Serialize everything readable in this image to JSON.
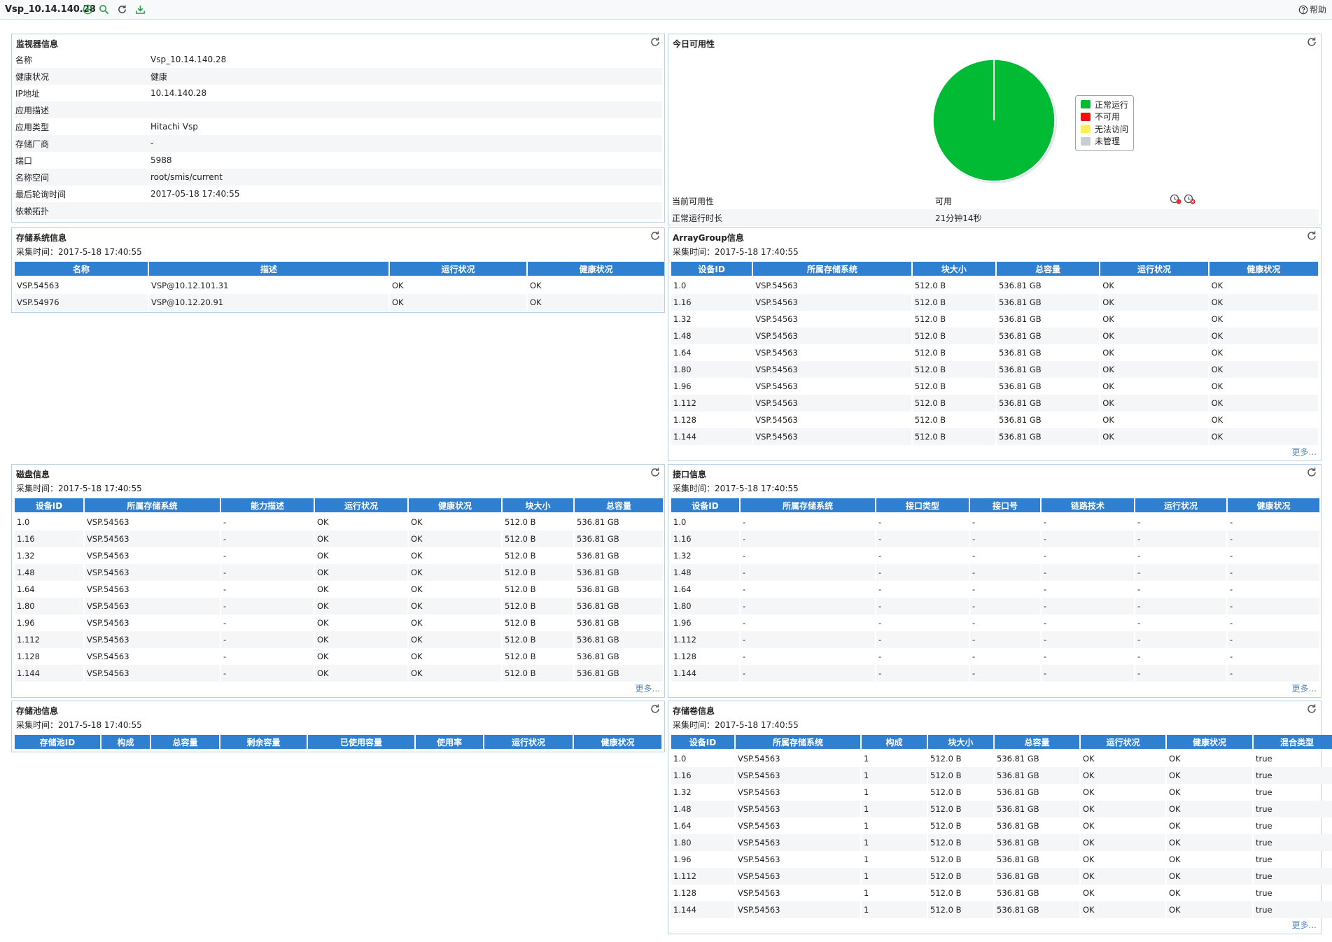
{
  "header": {
    "title": "Vsp_10.14.140.28",
    "help_label": "帮助"
  },
  "common": {
    "more_label": "更多...",
    "collect_time": "采集时间：2017-5-18 17:40:55"
  },
  "monitor": {
    "title": "监视器信息",
    "rows": [
      {
        "k": "名称",
        "v": "Vsp_10.14.140.28"
      },
      {
        "k": "健康状况",
        "v": "健康"
      },
      {
        "k": "IP地址",
        "v": "10.14.140.28"
      },
      {
        "k": "应用描述",
        "v": ""
      },
      {
        "k": "应用类型",
        "v": "Hitachi Vsp"
      },
      {
        "k": "存储厂商",
        "v": "-"
      },
      {
        "k": "端口",
        "v": "5988"
      },
      {
        "k": "名称空间",
        "v": "root/smis/current"
      },
      {
        "k": "最后轮询时间",
        "v": "2017-05-18 17:40:55"
      },
      {
        "k": "依赖拓扑",
        "v": ""
      }
    ]
  },
  "availability": {
    "title": "今日可用性",
    "legend": [
      {
        "label": "正常运行",
        "color": "#00bb33"
      },
      {
        "label": "不可用",
        "color": "#ee1111"
      },
      {
        "label": "无法访问",
        "color": "#ffee55"
      },
      {
        "label": "未管理",
        "color": "#c8ccd4"
      }
    ],
    "pie_values": {
      "正常运行": 100,
      "不可用": 0,
      "无法访问": 0,
      "未管理": 0
    },
    "rows": [
      {
        "k": "当前可用性",
        "v": "可用"
      },
      {
        "k": "正常运行时长",
        "v": "21分钟14秒"
      }
    ]
  },
  "storage_system": {
    "title": "存储系统信息",
    "headers": [
      "名称",
      "描述",
      "运行状况",
      "健康状况"
    ],
    "rows": [
      [
        "VSP.54563",
        "VSP@10.12.101.31",
        "OK",
        "OK"
      ],
      [
        "VSP.54976",
        "VSP@10.12.20.91",
        "OK",
        "OK"
      ]
    ]
  },
  "array_group": {
    "title": "ArrayGroup信息",
    "headers": [
      "设备ID",
      "所属存储系统",
      "块大小",
      "总容量",
      "运行状况",
      "健康状况"
    ],
    "rows": [
      [
        "1.0",
        "VSP.54563",
        "512.0 B",
        "536.81 GB",
        "OK",
        "OK"
      ],
      [
        "1.16",
        "VSP.54563",
        "512.0 B",
        "536.81 GB",
        "OK",
        "OK"
      ],
      [
        "1.32",
        "VSP.54563",
        "512.0 B",
        "536.81 GB",
        "OK",
        "OK"
      ],
      [
        "1.48",
        "VSP.54563",
        "512.0 B",
        "536.81 GB",
        "OK",
        "OK"
      ],
      [
        "1.64",
        "VSP.54563",
        "512.0 B",
        "536.81 GB",
        "OK",
        "OK"
      ],
      [
        "1.80",
        "VSP.54563",
        "512.0 B",
        "536.81 GB",
        "OK",
        "OK"
      ],
      [
        "1.96",
        "VSP.54563",
        "512.0 B",
        "536.81 GB",
        "OK",
        "OK"
      ],
      [
        "1.112",
        "VSP.54563",
        "512.0 B",
        "536.81 GB",
        "OK",
        "OK"
      ],
      [
        "1.128",
        "VSP.54563",
        "512.0 B",
        "536.81 GB",
        "OK",
        "OK"
      ],
      [
        "1.144",
        "VSP.54563",
        "512.0 B",
        "536.81 GB",
        "OK",
        "OK"
      ]
    ]
  },
  "disk": {
    "title": "磁盘信息",
    "headers": [
      "设备ID",
      "所属存储系统",
      "能力描述",
      "运行状况",
      "健康状况",
      "块大小",
      "总容量"
    ],
    "rows": [
      [
        "1.0",
        "VSP.54563",
        "-",
        "OK",
        "OK",
        "512.0 B",
        "536.81 GB"
      ],
      [
        "1.16",
        "VSP.54563",
        "-",
        "OK",
        "OK",
        "512.0 B",
        "536.81 GB"
      ],
      [
        "1.32",
        "VSP.54563",
        "-",
        "OK",
        "OK",
        "512.0 B",
        "536.81 GB"
      ],
      [
        "1.48",
        "VSP.54563",
        "-",
        "OK",
        "OK",
        "512.0 B",
        "536.81 GB"
      ],
      [
        "1.64",
        "VSP.54563",
        "-",
        "OK",
        "OK",
        "512.0 B",
        "536.81 GB"
      ],
      [
        "1.80",
        "VSP.54563",
        "-",
        "OK",
        "OK",
        "512.0 B",
        "536.81 GB"
      ],
      [
        "1.96",
        "VSP.54563",
        "-",
        "OK",
        "OK",
        "512.0 B",
        "536.81 GB"
      ],
      [
        "1.112",
        "VSP.54563",
        "-",
        "OK",
        "OK",
        "512.0 B",
        "536.81 GB"
      ],
      [
        "1.128",
        "VSP.54563",
        "-",
        "OK",
        "OK",
        "512.0 B",
        "536.81 GB"
      ],
      [
        "1.144",
        "VSP.54563",
        "-",
        "OK",
        "OK",
        "512.0 B",
        "536.81 GB"
      ]
    ]
  },
  "port": {
    "title": "接口信息",
    "headers": [
      "设备ID",
      "所属存储系统",
      "接口类型",
      "接口号",
      "链路技术",
      "运行状况",
      "健康状况"
    ],
    "rows": [
      [
        "1.0",
        "-",
        "-",
        "-",
        "-",
        "-",
        "-"
      ],
      [
        "1.16",
        "-",
        "-",
        "-",
        "-",
        "-",
        "-"
      ],
      [
        "1.32",
        "-",
        "-",
        "-",
        "-",
        "-",
        "-"
      ],
      [
        "1.48",
        "-",
        "-",
        "-",
        "-",
        "-",
        "-"
      ],
      [
        "1.64",
        "-",
        "-",
        "-",
        "-",
        "-",
        "-"
      ],
      [
        "1.80",
        "-",
        "-",
        "-",
        "-",
        "-",
        "-"
      ],
      [
        "1.96",
        "-",
        "-",
        "-",
        "-",
        "-",
        "-"
      ],
      [
        "1.112",
        "-",
        "-",
        "-",
        "-",
        "-",
        "-"
      ],
      [
        "1.128",
        "-",
        "-",
        "-",
        "-",
        "-",
        "-"
      ],
      [
        "1.144",
        "-",
        "-",
        "-",
        "-",
        "-",
        "-"
      ]
    ]
  },
  "pool": {
    "title": "存储池信息",
    "headers": [
      "存储池ID",
      "构成",
      "总容量",
      "剩余容量",
      "已使用容量",
      "使用率",
      "运行状况",
      "健康状况"
    ],
    "rows": []
  },
  "volume": {
    "title": "存储卷信息",
    "headers": [
      "设备ID",
      "所属存储系统",
      "构成",
      "块大小",
      "总容量",
      "运行状况",
      "健康状况",
      "混合类型"
    ],
    "rows": [
      [
        "1.0",
        "VSP.54563",
        "1",
        "512.0 B",
        "536.81 GB",
        "OK",
        "OK",
        "true"
      ],
      [
        "1.16",
        "VSP.54563",
        "1",
        "512.0 B",
        "536.81 GB",
        "OK",
        "OK",
        "true"
      ],
      [
        "1.32",
        "VSP.54563",
        "1",
        "512.0 B",
        "536.81 GB",
        "OK",
        "OK",
        "true"
      ],
      [
        "1.48",
        "VSP.54563",
        "1",
        "512.0 B",
        "536.81 GB",
        "OK",
        "OK",
        "true"
      ],
      [
        "1.64",
        "VSP.54563",
        "1",
        "512.0 B",
        "536.81 GB",
        "OK",
        "OK",
        "true"
      ],
      [
        "1.80",
        "VSP.54563",
        "1",
        "512.0 B",
        "536.81 GB",
        "OK",
        "OK",
        "true"
      ],
      [
        "1.96",
        "VSP.54563",
        "1",
        "512.0 B",
        "536.81 GB",
        "OK",
        "OK",
        "true"
      ],
      [
        "1.112",
        "VSP.54563",
        "1",
        "512.0 B",
        "536.81 GB",
        "OK",
        "OK",
        "true"
      ],
      [
        "1.128",
        "VSP.54563",
        "1",
        "512.0 B",
        "536.81 GB",
        "OK",
        "OK",
        "true"
      ],
      [
        "1.144",
        "VSP.54563",
        "1",
        "512.0 B",
        "536.81 GB",
        "OK",
        "OK",
        "true"
      ]
    ]
  }
}
